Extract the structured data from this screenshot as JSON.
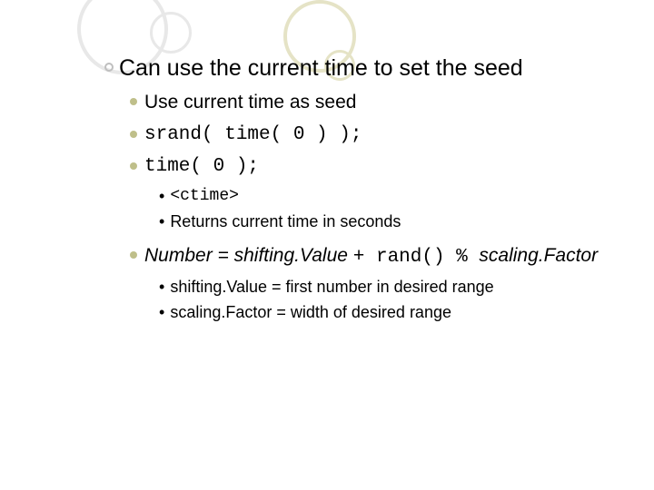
{
  "slide": {
    "heading": "Can use the current time to set the seed",
    "items": [
      "Use current time as seed",
      "srand( time( 0 ) );",
      "time( 0 );"
    ],
    "time_sub": [
      "<ctime>",
      "Returns current time in seconds"
    ],
    "formula": {
      "plain1": "Number = shifting.Value ",
      "code": "+ rand() % ",
      "plain2": "scaling.Factor"
    },
    "formula_sub": [
      "shifting.Value = first number in desired range",
      "scaling.Factor = width of desired range"
    ]
  }
}
